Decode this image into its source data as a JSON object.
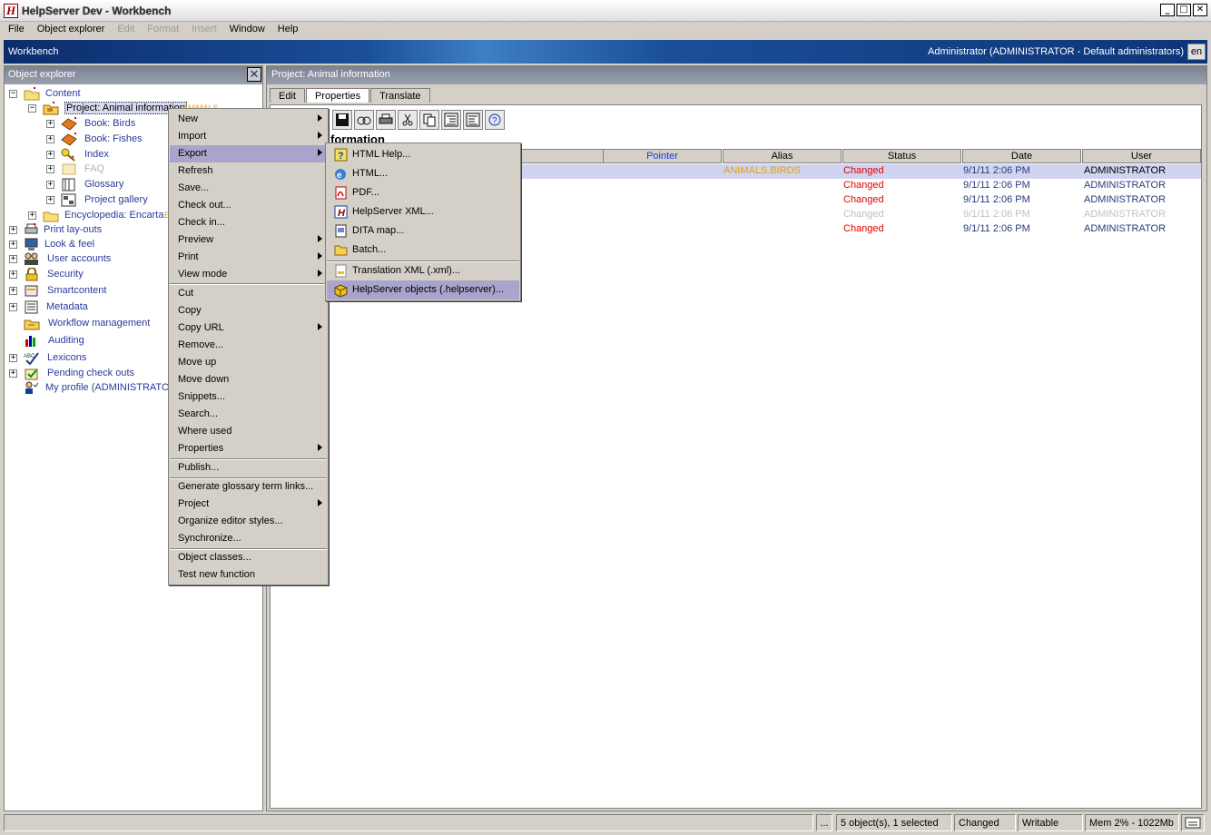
{
  "window": {
    "title": "HelpServer Dev - Workbench",
    "icon_letter": "H",
    "minimize": "_",
    "maximize": "□",
    "close": "✕"
  },
  "menubar": [
    {
      "label": "File",
      "enabled": true
    },
    {
      "label": "Object explorer",
      "enabled": true
    },
    {
      "label": "Edit",
      "enabled": false
    },
    {
      "label": "Format",
      "enabled": false
    },
    {
      "label": "Insert",
      "enabled": false
    },
    {
      "label": "Window",
      "enabled": true
    },
    {
      "label": "Help",
      "enabled": true
    }
  ],
  "workbench": {
    "title": "Workbench",
    "user": "Administrator (ADMINISTRATOR - Default administrators)",
    "language": "en"
  },
  "explorer": {
    "title": "Object explorer",
    "close_glyph": "✕",
    "nodes": [
      {
        "label": "Content",
        "icon": "folder-icon"
      },
      {
        "label": "Project: Animal information",
        "tag": "ANIMALS",
        "icon": "project-folder-icon"
      },
      {
        "label": "Book: Birds",
        "icon": "book-icon"
      },
      {
        "label": "Book: Fishes",
        "icon": "book-icon"
      },
      {
        "label": "Index",
        "icon": "key-icon"
      },
      {
        "label": "FAQ",
        "icon": "faq-icon"
      },
      {
        "label": "Glossary",
        "icon": "glossary-icon"
      },
      {
        "label": "Project gallery",
        "icon": "gallery-icon"
      },
      {
        "label": "Encyclopedia: Encarta",
        "tag": "E",
        "icon": "folder-icon"
      },
      {
        "label": "Print lay-outs",
        "icon": "printer-icon"
      },
      {
        "label": "Look & feel",
        "icon": "monitor-icon"
      },
      {
        "label": "User accounts",
        "icon": "users-icon"
      },
      {
        "label": "Security",
        "icon": "lock-icon"
      },
      {
        "label": "Smartcontent",
        "icon": "smartcontent-icon"
      },
      {
        "label": "Metadata",
        "icon": "metadata-icon"
      },
      {
        "label": "Workflow management",
        "icon": "workflow-icon"
      },
      {
        "label": "Auditing",
        "icon": "chart-icon"
      },
      {
        "label": "Lexicons",
        "icon": "spellcheck-icon"
      },
      {
        "label": "Pending check outs",
        "icon": "checkout-icon"
      },
      {
        "label": "My profile (ADMINISTRATOR",
        "icon": "user-icon"
      }
    ]
  },
  "panel": {
    "header": "Project: Animal information",
    "tabs": [
      "Edit",
      "Properties",
      "Translate"
    ],
    "heading": "formation",
    "columns": [
      "Pointer",
      "Alias",
      "Status",
      "Date",
      "User"
    ],
    "rows": [
      {
        "alias": "ANIMALS.BIRDS",
        "status": "Changed",
        "date": "9/1/11 2:06 PM",
        "user": "ADMINISTRATOR"
      },
      {
        "alias": "",
        "status": "Changed",
        "date": "9/1/11 2:06 PM",
        "user": "ADMINISTRATOR"
      },
      {
        "alias": "",
        "status": "Changed",
        "date": "9/1/11 2:06 PM",
        "user": "ADMINISTRATOR"
      },
      {
        "alias": "",
        "status": "Changed",
        "date": "9/1/11 2:06 PM",
        "user": "ADMINISTRATOR"
      },
      {
        "alias": "",
        "status": "Changed",
        "date": "9/1/11 2:06 PM",
        "user": "ADMINISTRATOR"
      }
    ]
  },
  "context_menu": [
    {
      "label": "New",
      "submenu": true
    },
    {
      "label": "Import",
      "submenu": true
    },
    {
      "label": "Export",
      "submenu": true,
      "highlighted": true
    },
    {
      "label": "Refresh"
    },
    {
      "label": "Save..."
    },
    {
      "label": "Check out..."
    },
    {
      "label": "Check in..."
    },
    {
      "label": "Preview",
      "submenu": true
    },
    {
      "label": "Print",
      "submenu": true
    },
    {
      "label": "View mode",
      "submenu": true
    },
    {
      "label": "Cut"
    },
    {
      "label": "Copy"
    },
    {
      "label": "Copy URL",
      "submenu": true
    },
    {
      "label": "Remove..."
    },
    {
      "label": "Move up"
    },
    {
      "label": "Move down"
    },
    {
      "label": "Snippets..."
    },
    {
      "label": "Search..."
    },
    {
      "label": "Where used"
    },
    {
      "label": "Properties",
      "submenu": true
    },
    {
      "label": "Publish..."
    },
    {
      "label": "Generate glossary term links..."
    },
    {
      "label": "Project",
      "submenu": true
    },
    {
      "label": "Organize editor styles..."
    },
    {
      "label": "Synchronize..."
    },
    {
      "label": "Object classes..."
    },
    {
      "label": "Test new function"
    }
  ],
  "export_menu": [
    {
      "label": "HTML Help...",
      "icon": "htmlhelp-icon"
    },
    {
      "label": "HTML...",
      "icon": "ie-icon"
    },
    {
      "label": "PDF...",
      "icon": "pdf-icon"
    },
    {
      "label": "HelpServer XML...",
      "icon": "helpserver-icon"
    },
    {
      "label": "DITA map...",
      "icon": "dita-icon"
    },
    {
      "label": "Batch...",
      "icon": "folder-icon"
    },
    {
      "label": "Translation XML (.xml)...",
      "icon": "xml-icon"
    },
    {
      "label": "HelpServer objects (.helpserver)...",
      "icon": "package-icon",
      "highlighted": true
    }
  ],
  "statusbar": {
    "more": "...",
    "objects": "5 object(s), 1 selected",
    "state": "Changed",
    "access": "Writable",
    "memory": "Mem 2% - 1022Mb"
  }
}
